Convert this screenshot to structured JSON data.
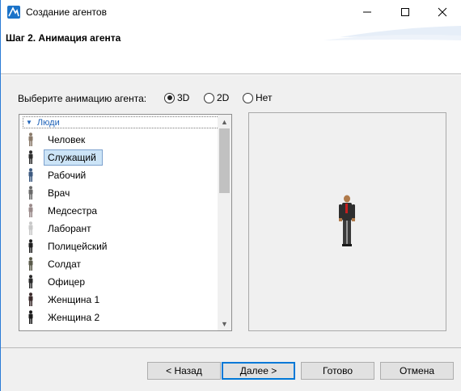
{
  "window": {
    "title": "Создание агентов",
    "icon": "anylogic-logo-icon",
    "accent": "#2b7bd6"
  },
  "header": {
    "step_title": "Шаг 2. Анимация агента"
  },
  "animation": {
    "prompt": "Выберите анимацию агента:",
    "options": [
      {
        "label": "3D",
        "checked": true
      },
      {
        "label": "2D",
        "checked": false
      },
      {
        "label": "Нет",
        "checked": false
      }
    ]
  },
  "list": {
    "group": "Люди",
    "items": [
      {
        "label": "Человек",
        "icon": "person-figure-icon",
        "color": "#8a7a6a"
      },
      {
        "label": "Служащий",
        "icon": "office-worker-figure-icon",
        "color": "#2d2d2d",
        "selected": true
      },
      {
        "label": "Рабочий",
        "icon": "worker-figure-icon",
        "color": "#3d5a80"
      },
      {
        "label": "Врач",
        "icon": "doctor-figure-icon",
        "color": "#6a6a6a"
      },
      {
        "label": "Медсестра",
        "icon": "nurse-figure-icon",
        "color": "#9a8a8a"
      },
      {
        "label": "Лаборант",
        "icon": "lab-assistant-figure-icon",
        "color": "#c8c8c8"
      },
      {
        "label": "Полицейский",
        "icon": "police-figure-icon",
        "color": "#1f1f1f"
      },
      {
        "label": "Солдат",
        "icon": "soldier-figure-icon",
        "color": "#5a5a4a"
      },
      {
        "label": "Офицер",
        "icon": "officer-figure-icon",
        "color": "#2a2a2a"
      },
      {
        "label": "Женщина 1",
        "icon": "woman-figure-icon",
        "color": "#3a2a2a"
      },
      {
        "label": "Женщина 2",
        "icon": "woman-figure-icon",
        "color": "#1a1a1a"
      }
    ]
  },
  "footer": {
    "back_label": "< Назад",
    "next_label": "Далее >",
    "done_label": "Готово",
    "cancel_label": "Отмена"
  }
}
